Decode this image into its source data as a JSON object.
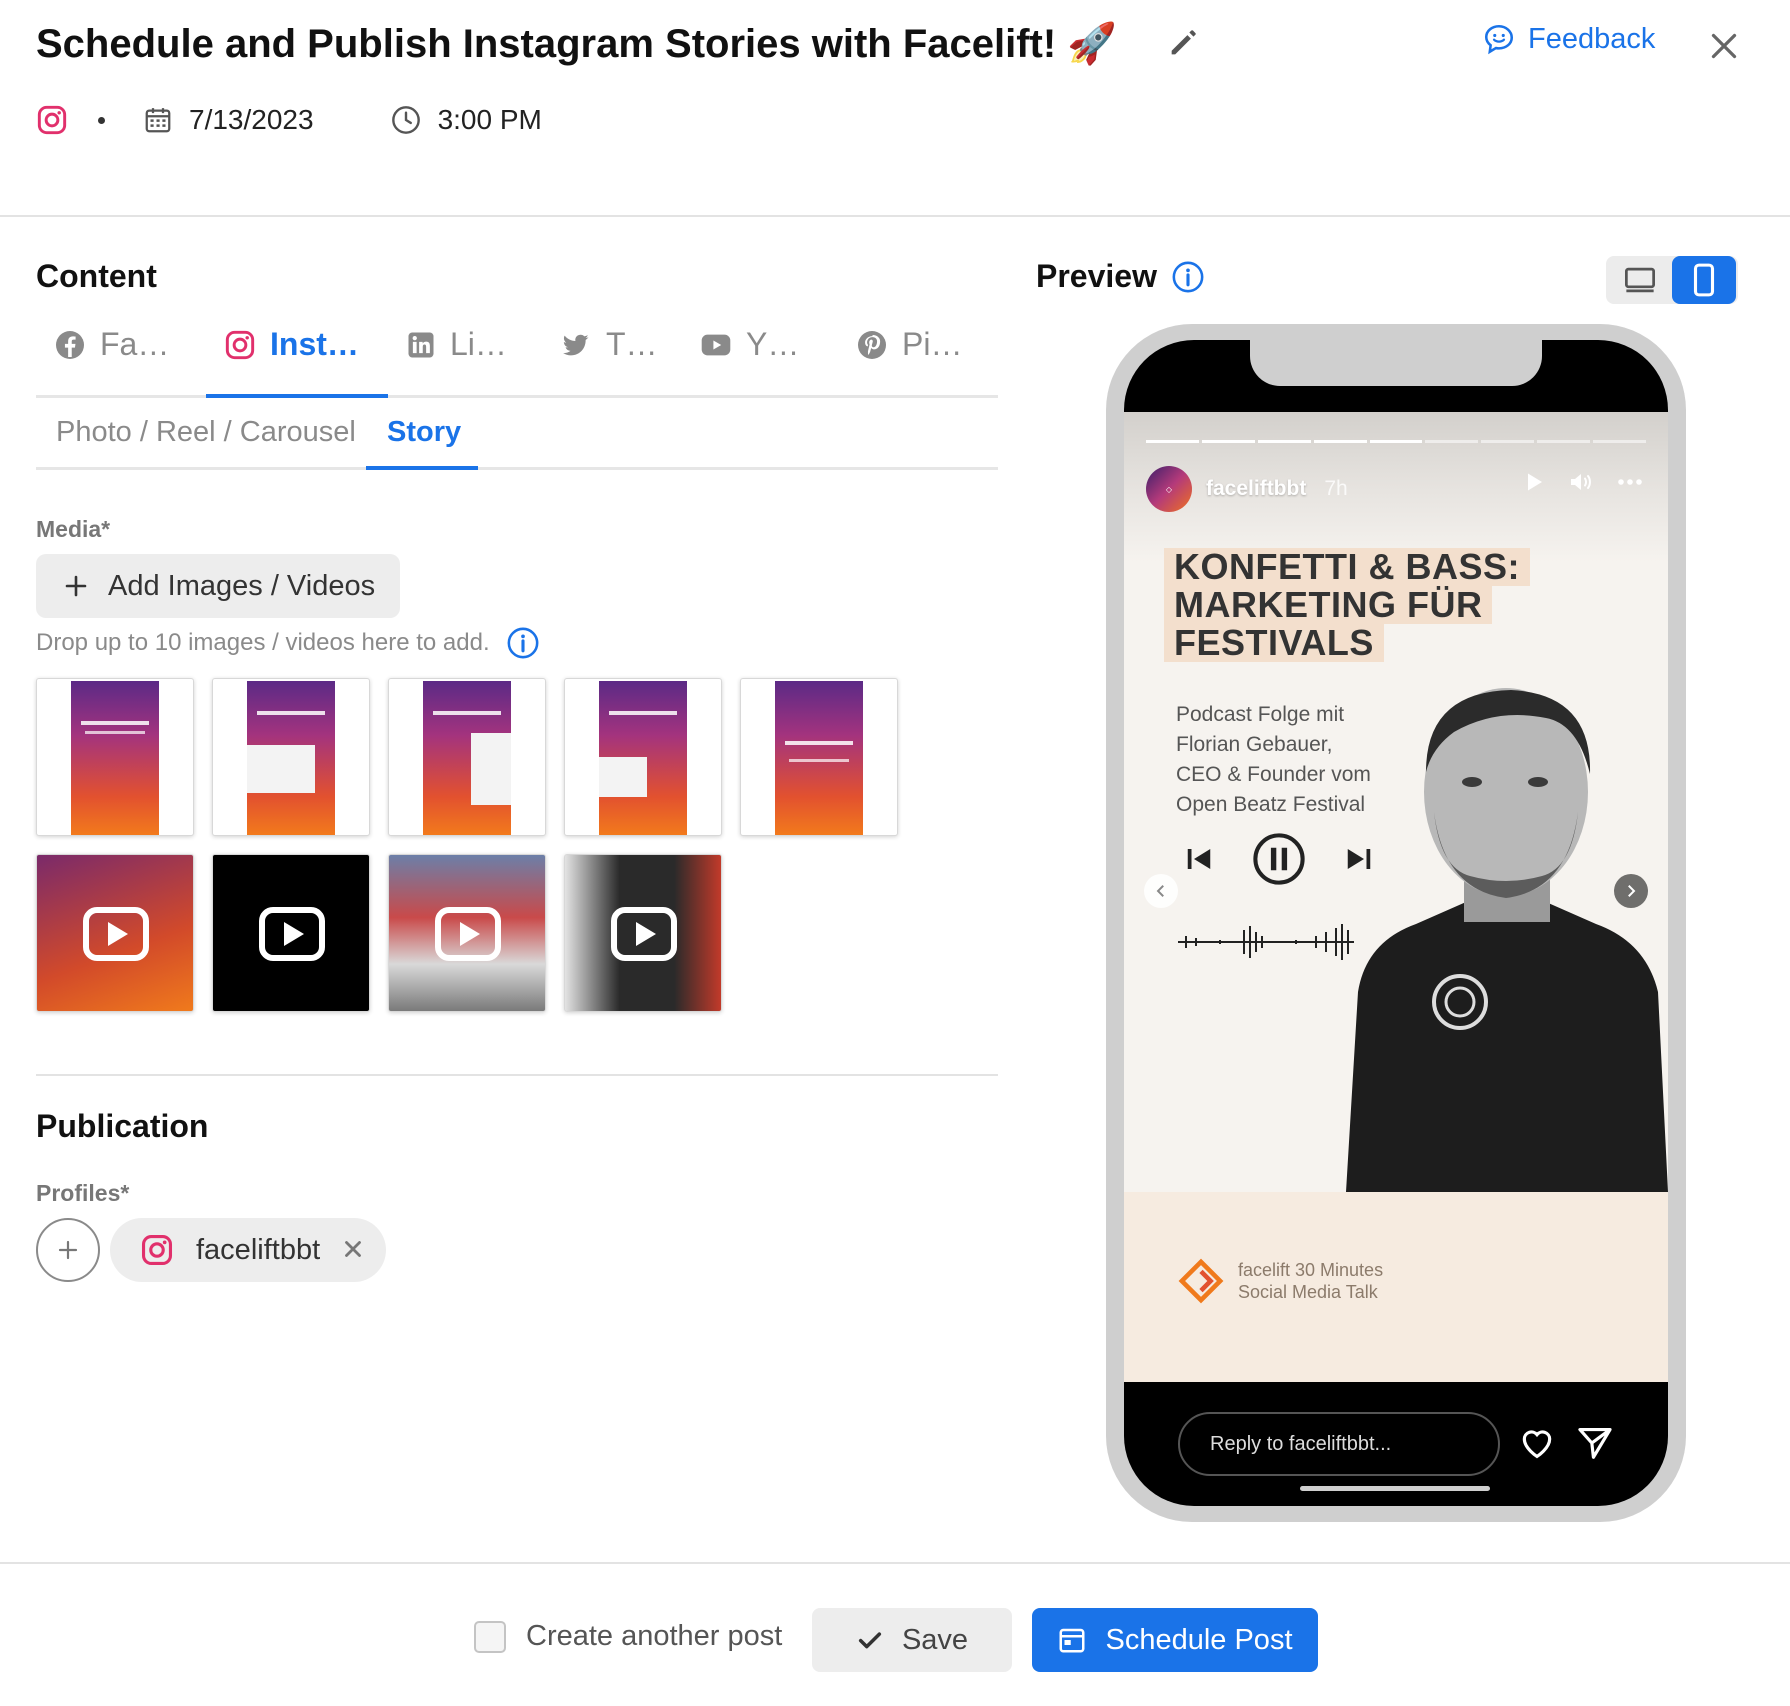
{
  "header": {
    "title": "Schedule and Publish Instagram Stories with Facelift! 🚀",
    "feedback_label": "Feedback",
    "date": "7/13/2023",
    "time": "3:00 PM"
  },
  "content": {
    "title": "Content",
    "network_tabs": [
      {
        "label": "Fa…",
        "icon": "facebook-icon"
      },
      {
        "label": "Inst…",
        "icon": "instagram-icon",
        "active": true
      },
      {
        "label": "Li…",
        "icon": "linkedin-icon"
      },
      {
        "label": "T…",
        "icon": "twitter-icon"
      },
      {
        "label": "Y…",
        "icon": "youtube-icon"
      },
      {
        "label": "Pi…",
        "icon": "pinterest-icon"
      }
    ],
    "sub_tabs": [
      {
        "label": "Photo / Reel / Carousel"
      },
      {
        "label": "Story",
        "active": true
      }
    ],
    "media_label": "Media*",
    "add_media_label": "Add Images / Videos",
    "drop_hint": "Drop up to 10 images / videos here to add.",
    "media_items": [
      {
        "type": "image"
      },
      {
        "type": "image"
      },
      {
        "type": "image"
      },
      {
        "type": "image"
      },
      {
        "type": "image"
      },
      {
        "type": "video"
      },
      {
        "type": "video"
      },
      {
        "type": "video"
      },
      {
        "type": "video"
      }
    ]
  },
  "publication": {
    "title": "Publication",
    "profiles_label": "Profiles*",
    "profiles": [
      {
        "name": "faceliftbbt",
        "network": "instagram"
      }
    ]
  },
  "preview": {
    "title": "Preview",
    "story": {
      "username": "faceliftbbt",
      "age": "7h",
      "headline": [
        "KONFETTI & BASS:",
        "MARKETING FÜR",
        "FESTIVALS"
      ],
      "subline": [
        "Podcast Folge mit",
        "Florian Gebauer,",
        "CEO & Founder vom",
        "Open Beatz Festival"
      ],
      "brand_footer": [
        "facelift 30 Minutes",
        "Social Media Talk"
      ],
      "progress_done": 5,
      "progress_total": 9
    },
    "reply_placeholder": "Reply to faceliftbbt..."
  },
  "footer": {
    "create_another_label": "Create another post",
    "save_label": "Save",
    "schedule_label": "Schedule Post"
  },
  "colors": {
    "accent": "#1a73e8",
    "instagram": "#e1306c"
  }
}
